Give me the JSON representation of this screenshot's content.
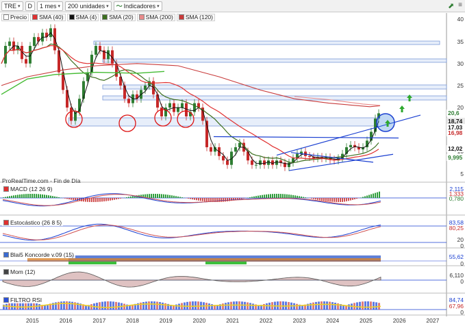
{
  "toolbar": {
    "symbol": "TRE",
    "d_label": "D",
    "period": "1 mes",
    "units": "200 unidades",
    "indicators": "Indicadores"
  },
  "legend": [
    {
      "label": "Precio",
      "color": "#ffffff"
    },
    {
      "label": "SMA (40)",
      "color": "#e03030"
    },
    {
      "label": "SMA (4)",
      "color": "#111111"
    },
    {
      "label": "SMA (20)",
      "color": "#3c6e1e"
    },
    {
      "label": "SMA (200)",
      "color": "#e88a8a"
    },
    {
      "label": "SMA (120)",
      "color": "#c83a3a"
    }
  ],
  "source_text": "ProRealTime.com - Fin de Día",
  "price_axis": [
    "40",
    "35",
    "30",
    "25",
    "20",
    "15",
    "10",
    "5"
  ],
  "price_tags": [
    {
      "text": "20,6",
      "color": "#2e7d32",
      "bg": "#ffffff"
    },
    {
      "text": "18,74",
      "color": "#111111",
      "bg": "#e8e8e8"
    },
    {
      "text": "17,03",
      "color": "#111111",
      "bg": "#ffffff"
    },
    {
      "text": "16,98",
      "color": "#c62828",
      "bg": "#ffffff"
    },
    {
      "text": "12,02",
      "color": "#111111",
      "bg": "#ffffff"
    },
    {
      "text": "9,995",
      "color": "#2e7d32",
      "bg": "#ffffff"
    }
  ],
  "panels": {
    "macd": {
      "title": "MACD (12 26 9)",
      "values": [
        "2,115",
        "1,333",
        "0,780"
      ]
    },
    "stoch": {
      "title": "Estocástico (26 8 5)",
      "values": [
        "83,58",
        "80,25",
        "20"
      ],
      "ticks": [
        "80",
        "20",
        "0"
      ]
    },
    "blai": {
      "title": "Blai5 Koncorde v.09 (15)",
      "values": [
        "55,62"
      ],
      "ticks": [
        "0"
      ]
    },
    "mom": {
      "title": "Mom (12)",
      "values": [
        "6,110"
      ],
      "ticks": [
        "0"
      ]
    },
    "filtro": {
      "title": "FILTRO RSI",
      "values": [
        "84,74",
        "67,96"
      ],
      "ticks": [
        "0"
      ]
    }
  },
  "years": [
    "2015",
    "2016",
    "2017",
    "2018",
    "2019",
    "2020",
    "2021",
    "2022",
    "2023",
    "2024",
    "2025",
    "2026",
    "2027"
  ],
  "colors": {
    "candle_up": "#2e7d32",
    "candle_down": "#c62828",
    "sma40": "#e03030",
    "sma20": "#3c6e1e",
    "sma4": "#111111",
    "sma200": "#e88a8a",
    "sma120": "#c83a3a",
    "channel": "#1a3fd1",
    "zone": "#c9d9f5"
  }
}
